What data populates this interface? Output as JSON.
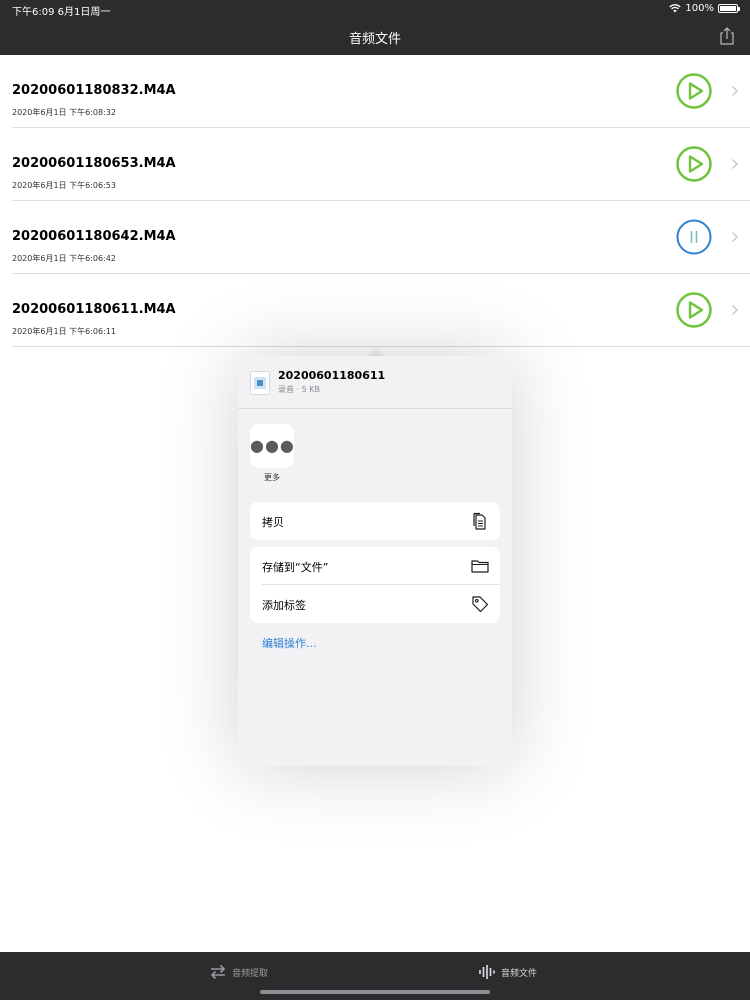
{
  "status_bar": {
    "time_date": "下午6:09   6月1日周一",
    "battery": "100%"
  },
  "nav": {
    "title": "音频文件",
    "share_icon": "share-icon"
  },
  "files": [
    {
      "name": "20200601180832.M4A",
      "date": "2020年6月1日 下午6:08:32",
      "state": "play"
    },
    {
      "name": "20200601180653.M4A",
      "date": "2020年6月1日 下午6:06:53",
      "state": "play"
    },
    {
      "name": "20200601180642.M4A",
      "date": "2020年6月1日 下午6:06:42",
      "state": "pause"
    },
    {
      "name": "20200601180611.M4A",
      "date": "2020年6月1日 下午6:06:11",
      "state": "play"
    }
  ],
  "share_sheet": {
    "file_name": "20200601180611",
    "file_meta": "录音 · 5 KB",
    "more_label": "更多",
    "groups": [
      [
        {
          "label": "拷贝",
          "icon": "copy-icon"
        }
      ],
      [
        {
          "label": "存储到“文件”",
          "icon": "folder-icon"
        },
        {
          "label": "添加标签",
          "icon": "tag-icon"
        }
      ]
    ],
    "edit_actions": "编辑操作..."
  },
  "tabs": [
    {
      "label": "音频提取",
      "icon": "arrows-swap-icon"
    },
    {
      "label": "音频文件",
      "icon": "waveform-icon"
    }
  ],
  "colors": {
    "play_green": "#6ec43a",
    "pause_blue": "#2f7fd3",
    "bar_dark": "#2c2c2e",
    "link_blue": "#2f7fd3"
  }
}
